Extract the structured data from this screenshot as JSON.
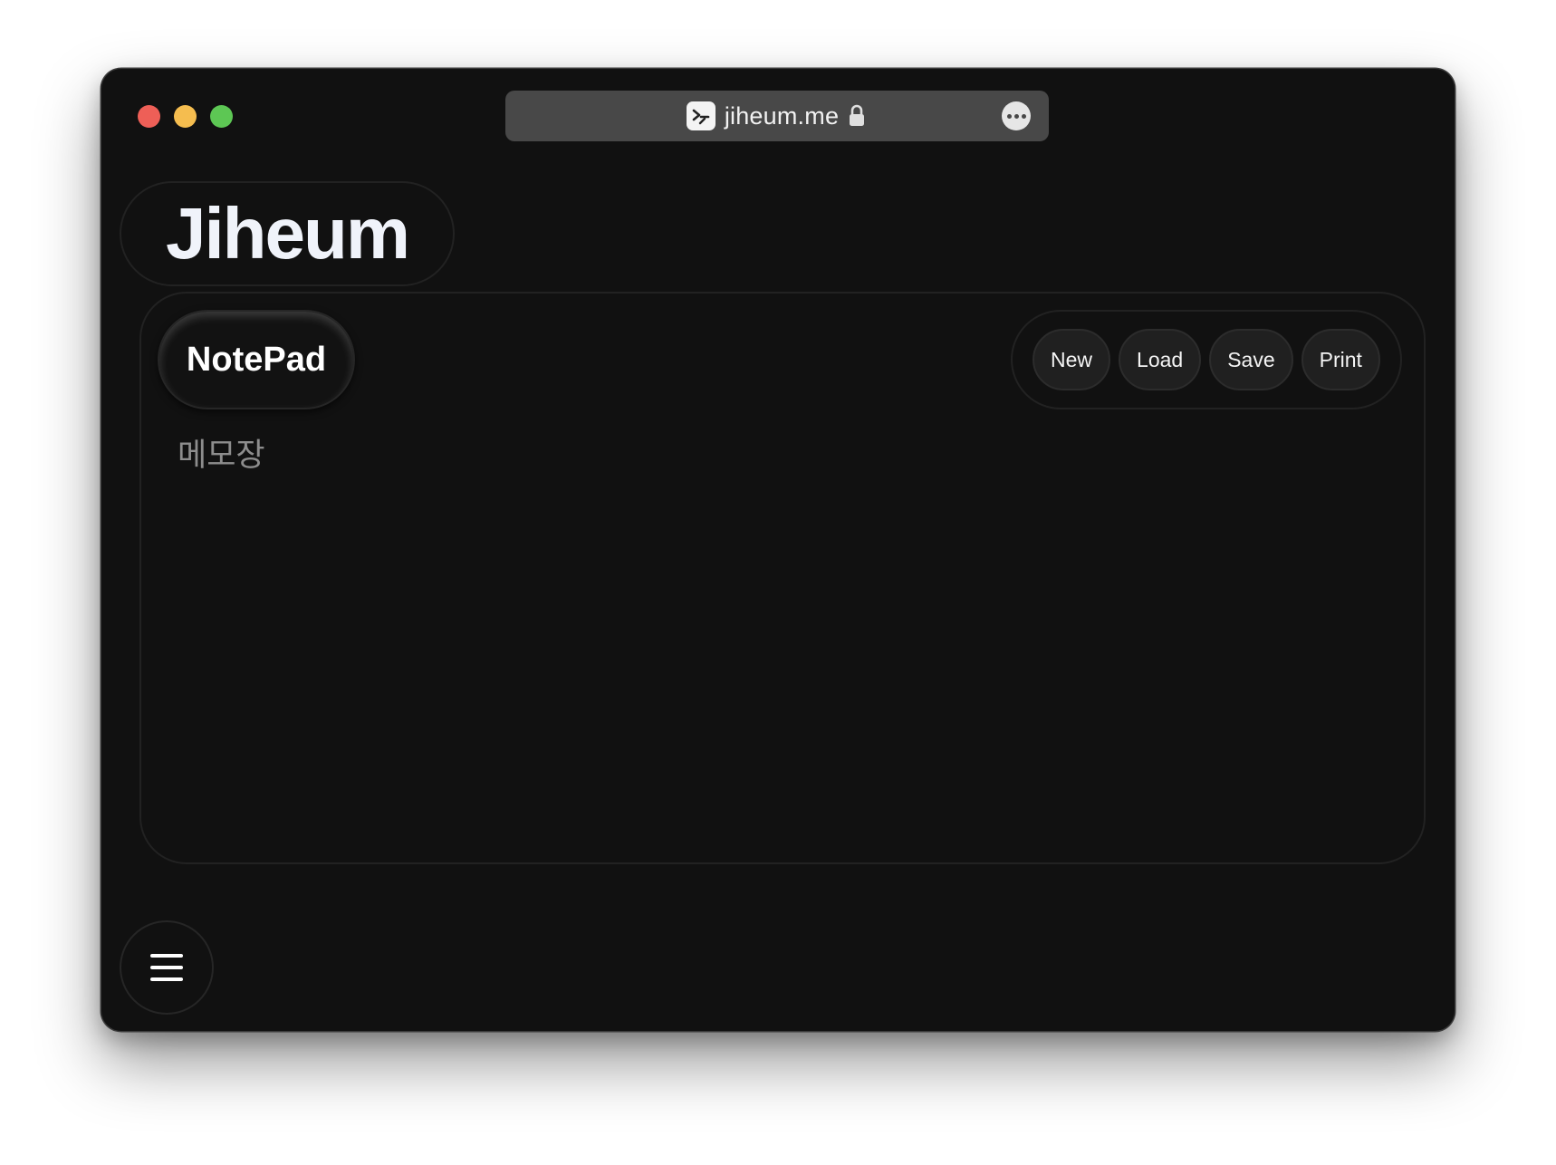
{
  "browser": {
    "url": "jiheum.me",
    "favicon_icon": "terminal-icon",
    "lock_icon": "lock-icon",
    "more_icon": "ellipsis-icon"
  },
  "brand": {
    "name": "Jiheum"
  },
  "notepad": {
    "title": "NotePad",
    "placeholder": "메모장",
    "toolbar": {
      "new_label": "New",
      "load_label": "Load",
      "save_label": "Save",
      "print_label": "Print"
    }
  },
  "menu": {
    "icon": "hamburger-menu-icon"
  },
  "colors": {
    "background": "#111111",
    "traffic_red": "#ee5f57",
    "traffic_yellow": "#f5bd4f",
    "traffic_green": "#5dc754"
  }
}
